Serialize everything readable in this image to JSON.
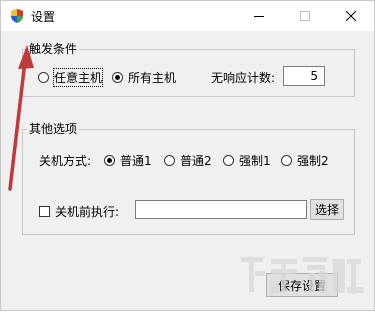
{
  "window": {
    "title": "设置",
    "icon": "shield-icon"
  },
  "trigger_group": {
    "legend": "触发条件",
    "options": [
      {
        "label": "任意主机",
        "selected": false
      },
      {
        "label": "所有主机",
        "selected": true
      }
    ],
    "timeout_label": "无响应计数:",
    "timeout_value": "5"
  },
  "other_group": {
    "legend": "其他选项",
    "shutdown_label": "关机方式:",
    "shutdown_options": [
      {
        "label": "普通1",
        "selected": true
      },
      {
        "label": "普通2",
        "selected": false
      },
      {
        "label": "强制1",
        "selected": false
      },
      {
        "label": "强制2",
        "selected": false
      }
    ],
    "pre_shutdown_label": "关机前执行:",
    "pre_shutdown_checked": false,
    "pre_shutdown_value": "",
    "browse_label": "选择"
  },
  "save_label": "保存设置",
  "colors": {
    "arrow": "#c0393b",
    "shield_red": "#d23b2a",
    "shield_blue": "#2a5bd2"
  }
}
